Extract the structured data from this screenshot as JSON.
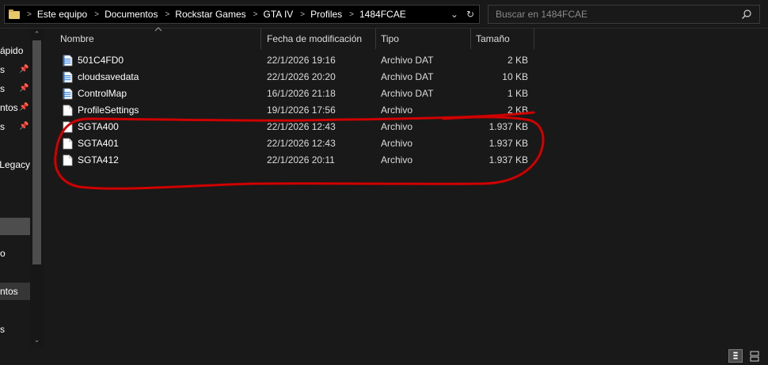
{
  "address": {
    "breadcrumbs": [
      "Este equipo",
      "Documentos",
      "Rockstar Games",
      "GTA IV",
      "Profiles",
      "1484FCAE"
    ],
    "dropdown_glyph": "⌄",
    "refresh_glyph": "↻"
  },
  "search": {
    "placeholder": "Buscar en 1484FCAE"
  },
  "nav": {
    "items": [
      {
        "label": "ápido",
        "pinned": false
      },
      {
        "label": "s",
        "pinned": true
      },
      {
        "label": "s",
        "pinned": true
      },
      {
        "label": "ntos",
        "pinned": true
      },
      {
        "label": "s",
        "pinned": true
      },
      {
        "label": "Legacy",
        "pinned": false
      },
      {
        "label": "o",
        "pinned": false
      },
      {
        "label": "ntos",
        "pinned": false
      },
      {
        "label": "s",
        "pinned": false
      }
    ],
    "pin_glyph": "📌",
    "scroll_up": "⌃",
    "scroll_down": "⌄"
  },
  "columns": {
    "name": "Nombre",
    "date": "Fecha de modificación",
    "type": "Tipo",
    "size": "Tamaño"
  },
  "files": [
    {
      "name": "501C4FD0",
      "date": "22/1/2026 19:16",
      "type": "Archivo DAT",
      "size": "2 KB",
      "icon": "dat-file-icon"
    },
    {
      "name": "cloudsavedata",
      "date": "22/1/2026 20:20",
      "type": "Archivo DAT",
      "size": "10 KB",
      "icon": "dat-file-icon"
    },
    {
      "name": "ControlMap",
      "date": "16/1/2026 21:18",
      "type": "Archivo DAT",
      "size": "1 KB",
      "icon": "dat-file-icon"
    },
    {
      "name": "ProfileSettings",
      "date": "19/1/2026 17:56",
      "type": "Archivo",
      "size": "2 KB",
      "icon": "blank-file-icon"
    },
    {
      "name": "SGTA400",
      "date": "22/1/2026 12:43",
      "type": "Archivo",
      "size": "1.937 KB",
      "icon": "blank-file-icon"
    },
    {
      "name": "SGTA401",
      "date": "22/1/2026 12:43",
      "type": "Archivo",
      "size": "1.937 KB",
      "icon": "blank-file-icon"
    },
    {
      "name": "SGTA412",
      "date": "22/1/2026 20:11",
      "type": "Archivo",
      "size": "1.937 KB",
      "icon": "blank-file-icon"
    }
  ],
  "colors": {
    "background": "#191919",
    "annotation": "#d00000",
    "dat_icon": "#4a8fd8"
  }
}
